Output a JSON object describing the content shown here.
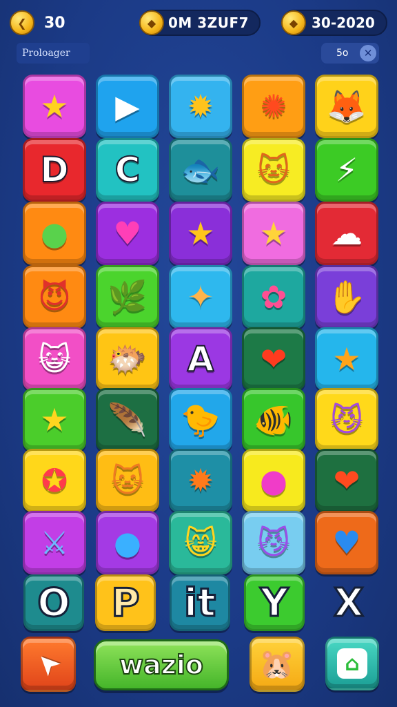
{
  "header": {
    "left_value": "30",
    "center_value": "0M 3ZUF7",
    "right_value": "30-2020"
  },
  "subbar": {
    "profile_label": "Proloager",
    "right_label": "5o",
    "close_symbol": "✕"
  },
  "colors": {
    "background": "#1b3a86",
    "coin": "#f6b71b",
    "play_button": "#45b52a"
  },
  "grid": {
    "rows": [
      [
        {
          "icon": "star-icon",
          "glyph": "★",
          "glyph_color": "#ffd21f",
          "bg": "#e84ce0"
        },
        {
          "icon": "play-icon",
          "glyph": "▶",
          "glyph_color": "#ffffff",
          "bg": "#1fa3ee"
        },
        {
          "icon": "sun-creature-icon",
          "glyph": "✹",
          "glyph_color": "#ffc31c",
          "bg": "#34b3ef"
        },
        {
          "icon": "sun-icon",
          "glyph": "✺",
          "glyph_color": "#ff4a1f",
          "bg": "#ff9e14"
        },
        {
          "icon": "fox-face-icon",
          "glyph": "🦊",
          "glyph_color": "#e06b1d",
          "bg": "#ffd21a"
        }
      ],
      [
        {
          "icon": "letter-tile-icon",
          "glyph": "D",
          "glyph_color": "#ffffff",
          "bg": "#e8282d",
          "letter": true
        },
        {
          "icon": "hook-icon",
          "glyph": "C",
          "glyph_color": "#ffffff",
          "bg": "#22c2c2",
          "letter": true
        },
        {
          "icon": "fish-icon",
          "glyph": "🐟",
          "glyph_color": "#7ad35a",
          "bg": "#1e8f9a"
        },
        {
          "icon": "cat-face-icon",
          "glyph": "🐱",
          "glyph_color": "#e0661c",
          "bg": "#f7ec23"
        },
        {
          "icon": "rainbow-bolt-icon",
          "glyph": "⚡",
          "glyph_color": "#ffffff",
          "bg": "#3ccb25"
        }
      ],
      [
        {
          "icon": "slime-icon",
          "glyph": "●",
          "glyph_color": "#59d24c",
          "bg": "#ff8a12"
        },
        {
          "icon": "heart-icon",
          "glyph": "♥",
          "glyph_color": "#ff3fb7",
          "bg": "#9c2fe0"
        },
        {
          "icon": "star-icon",
          "glyph": "★",
          "glyph_color": "#ffc61a",
          "bg": "#8a2fd9"
        },
        {
          "icon": "star-face-icon",
          "glyph": "★",
          "glyph_color": "#ffd43a",
          "bg": "#f06ce0"
        },
        {
          "icon": "cloud-icon",
          "glyph": "☁",
          "glyph_color": "#ffffff",
          "bg": "#e32a35"
        }
      ],
      [
        {
          "icon": "devil-cat-icon",
          "glyph": "😈",
          "glyph_color": "#e0302b",
          "bg": "#ff8a12"
        },
        {
          "icon": "leaf-icon",
          "glyph": "🌿",
          "glyph_color": "#2fbd3d",
          "bg": "#4bd42d"
        },
        {
          "icon": "cookie-icon",
          "glyph": "✦",
          "glyph_color": "#ffb44a",
          "bg": "#2eb8ee"
        },
        {
          "icon": "monster-icon",
          "glyph": "✿",
          "glyph_color": "#ff4f93",
          "bg": "#1ea89f"
        },
        {
          "icon": "hand-icon",
          "glyph": "✋",
          "glyph_color": "#ffffff",
          "bg": "#7a3fd9"
        }
      ],
      [
        {
          "icon": "white-cat-icon",
          "glyph": "😺",
          "glyph_color": "#ffffff",
          "bg": "#f24fc6"
        },
        {
          "icon": "blue-fish-icon",
          "glyph": "🐡",
          "glyph_color": "#2f9aee",
          "bg": "#ffc514"
        },
        {
          "icon": "letter-a-icon",
          "glyph": "A",
          "glyph_color": "#ffffff",
          "bg": "#9b38e3",
          "letter": true
        },
        {
          "icon": "red-heart-icon",
          "glyph": "❤",
          "glyph_color": "#ff3b1f",
          "bg": "#1d7a47"
        },
        {
          "icon": "star-icon",
          "glyph": "★",
          "glyph_color": "#ffa41a",
          "bg": "#25b6ec"
        }
      ],
      [
        {
          "icon": "yellow-star-face-icon",
          "glyph": "★",
          "glyph_color": "#ffd51f",
          "bg": "#4bcd2b"
        },
        {
          "icon": "feather-icon",
          "glyph": "🪶",
          "glyph_color": "#ff7a2a",
          "bg": "#1d6f43"
        },
        {
          "icon": "yellow-bird-icon",
          "glyph": "🐤",
          "glyph_color": "#ffd21a",
          "bg": "#22a7ea"
        },
        {
          "icon": "red-fish-icon",
          "glyph": "🐠",
          "glyph_color": "#ff3a2a",
          "bg": "#37c62c"
        },
        {
          "icon": "purple-cat-icon",
          "glyph": "😼",
          "glyph_color": "#a34ae0",
          "bg": "#ffd91a"
        }
      ],
      [
        {
          "icon": "star-play-icon",
          "glyph": "✪",
          "glyph_color": "#ff3b4b",
          "bg": "#ffd71a"
        },
        {
          "icon": "cat-face-icon",
          "glyph": "🐱",
          "glyph_color": "#ee7a22",
          "bg": "#ffbd14"
        },
        {
          "icon": "orange-monster-icon",
          "glyph": "✹",
          "glyph_color": "#ff7a1a",
          "bg": "#1e8fa6"
        },
        {
          "icon": "pink-slime-icon",
          "glyph": "●",
          "glyph_color": "#f03cc8",
          "bg": "#f7ea1e"
        },
        {
          "icon": "red-heart-icon",
          "glyph": "❤",
          "glyph_color": "#ff4a1f",
          "bg": "#1e7040"
        }
      ],
      [
        {
          "icon": "sword-icon",
          "glyph": "⚔",
          "glyph_color": "#6fb8ff",
          "bg": "#c23ee6"
        },
        {
          "icon": "bomb-icon",
          "glyph": "●",
          "glyph_color": "#3ab0ff",
          "bg": "#a43ae4"
        },
        {
          "icon": "yellow-cat-icon",
          "glyph": "😸",
          "glyph_color": "#ffd51f",
          "bg": "#2ab99a"
        },
        {
          "icon": "purple-cat-icon",
          "glyph": "😼",
          "glyph_color": "#9a4ee8",
          "bg": "#78cdf0"
        },
        {
          "icon": "blue-heart-icon",
          "glyph": "♥",
          "glyph_color": "#2a8bef",
          "bg": "#ee6a1a"
        }
      ]
    ]
  },
  "letter_row": [
    {
      "icon": "ring-icon",
      "glyph": "O",
      "bg": "#1e8b8e"
    },
    {
      "icon": "letter-p-icon",
      "glyph": "P",
      "bg": "#ffc21a"
    },
    {
      "icon": "letters-it-icon",
      "glyph": "it",
      "bg": "#1e88a2"
    },
    {
      "icon": "letter-y-icon",
      "glyph": "Y",
      "bg": "#3ccb2f"
    },
    {
      "icon": "letter-x-icon",
      "glyph": "X",
      "bg": ""
    }
  ],
  "bottom_bar": {
    "arrow_glyph": "➤",
    "play_label": "wazio",
    "mascot_glyph": "🐹",
    "home_glyph": "⌂"
  }
}
